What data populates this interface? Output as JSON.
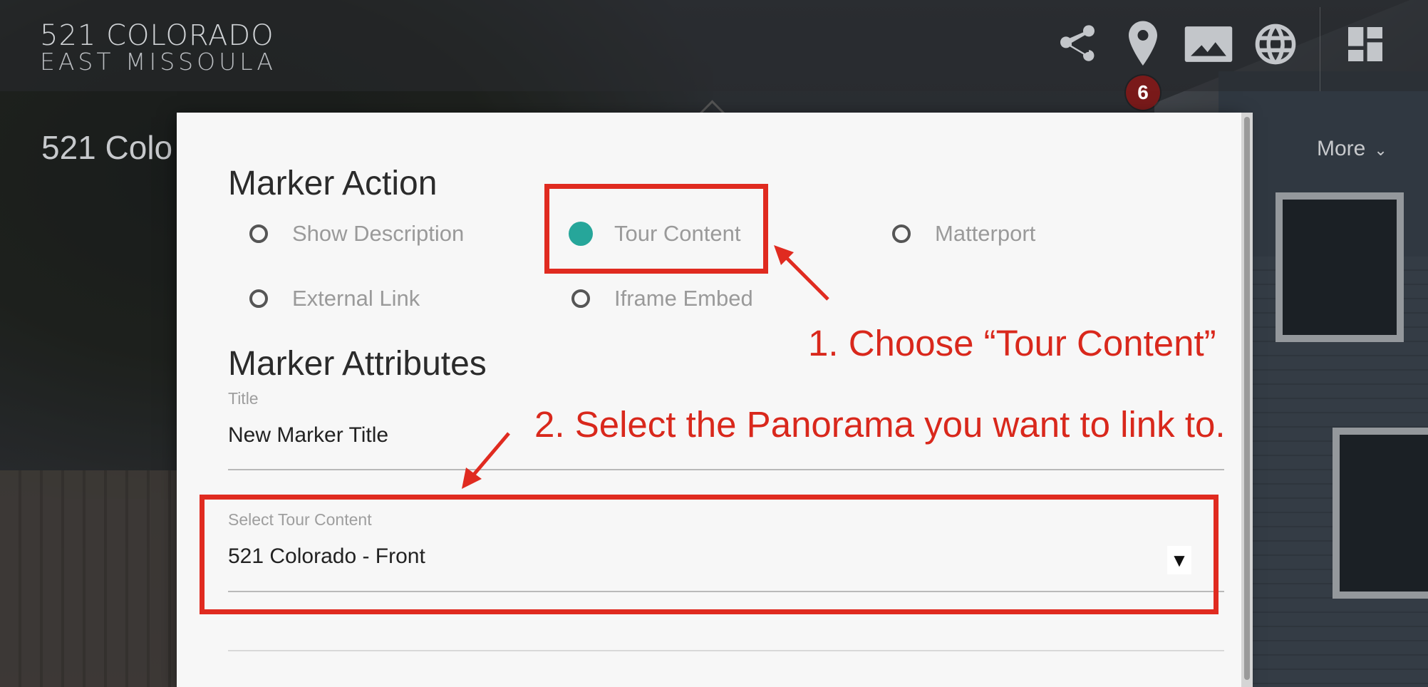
{
  "header": {
    "logo_line1": "521 COLORADO",
    "logo_line2": "EAST MISSOULA",
    "icons": [
      "share-icon",
      "map-marker-icon",
      "image-icon",
      "globe-icon",
      "dashboard-icon"
    ],
    "marker_badge": "6"
  },
  "page": {
    "title": "521 Colo",
    "more_label": "More",
    "more_chevron": "⌄"
  },
  "dialog": {
    "marker_action_title": "Marker Action",
    "actions": [
      {
        "label": "Show Description",
        "selected": false
      },
      {
        "label": "Tour Content",
        "selected": true
      },
      {
        "label": "Matterport",
        "selected": false
      },
      {
        "label": "External Link",
        "selected": false
      },
      {
        "label": "Iframe Embed",
        "selected": false
      }
    ],
    "marker_attributes_title": "Marker Attributes",
    "title_field": {
      "label": "Title",
      "value": "New Marker Title"
    },
    "tour_content_select": {
      "label": "Select Tour Content",
      "value": "521 Colorado - Front",
      "arrow": "▼"
    }
  },
  "annotations": {
    "step1": "1. Choose “Tour Content”",
    "step2": "2. Select the Panorama you want to link to."
  },
  "colors": {
    "accent_radio": "#26a69a",
    "annotation_red": "#e02b20",
    "badge": "#7a1a1a"
  }
}
